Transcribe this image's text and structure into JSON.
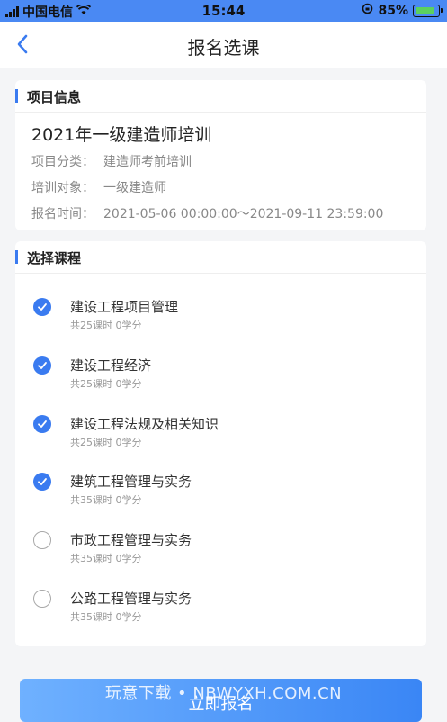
{
  "status": {
    "carrier": "中国电信",
    "time": "15:44",
    "battery": "85%"
  },
  "nav": {
    "title": "报名选课"
  },
  "project": {
    "header": "项目信息",
    "name": "2021年一级建造师培训",
    "rows": [
      {
        "label": "项目分类：",
        "value": "建造师考前培训"
      },
      {
        "label": "培训对象：",
        "value": "一级建造师"
      },
      {
        "label": "报名时间：",
        "value": "2021-05-06 00:00:00～2021-09-11 23:59:00"
      }
    ]
  },
  "courses": {
    "header": "选择课程",
    "items": [
      {
        "name": "建设工程项目管理",
        "meta": "共25课时 0学分",
        "checked": true
      },
      {
        "name": "建设工程经济",
        "meta": "共25课时 0学分",
        "checked": true
      },
      {
        "name": "建设工程法规及相关知识",
        "meta": "共25课时 0学分",
        "checked": true
      },
      {
        "name": "建筑工程管理与实务",
        "meta": "共35课时 0学分",
        "checked": true
      },
      {
        "name": "市政工程管理与实务",
        "meta": "共35课时 0学分",
        "checked": false
      },
      {
        "name": "公路工程管理与实务",
        "meta": "共35课时 0学分",
        "checked": false
      }
    ]
  },
  "submit_label": "立即报名",
  "watermark": "玩意下载 • NBWYXH.COM.CN",
  "colors": {
    "accent": "#3a7bf0",
    "statusbar": "#4a89f3"
  }
}
